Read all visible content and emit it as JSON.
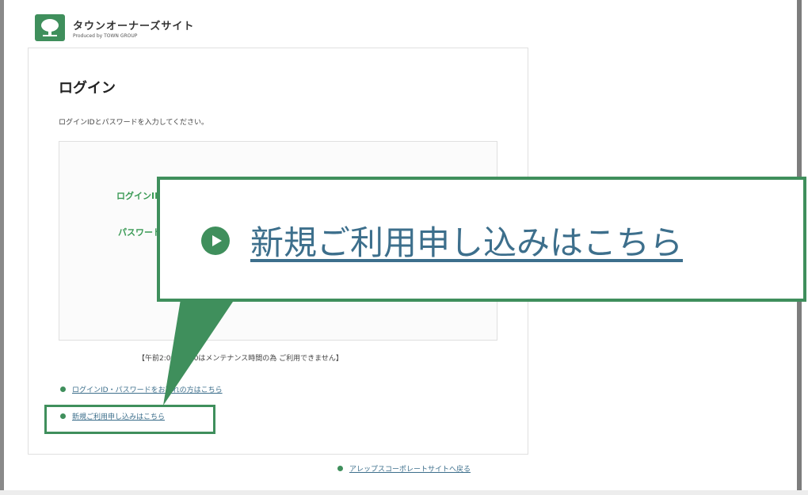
{
  "header": {
    "site_name": "タウンオーナーズサイト",
    "site_sub": "Produced by TOWN GROUP"
  },
  "login": {
    "title": "ログイン",
    "description": "ログインIDとパスワードを入力してください。",
    "id_label": "ログインID",
    "password_label": "パスワード",
    "maintenance_notice": "【午前2:00〜6:00はメンテナンス時間の為 ご利用できません】"
  },
  "links": {
    "forgot": "ログインID・パスワードをお忘れの方はこちら",
    "signup": "新規ご利用申し込みはこちら",
    "back_to_corporate": "アレップスコーポレートサイトへ戻る"
  },
  "callout": {
    "text": "新規ご利用申し込みはこちら"
  },
  "colors": {
    "brand_green": "#3f8f5c",
    "link_blue": "#3d6f8c"
  },
  "icons": {
    "logo": "tree-logo-icon",
    "bullet": "green-dot-icon",
    "play": "play-circle-icon"
  }
}
